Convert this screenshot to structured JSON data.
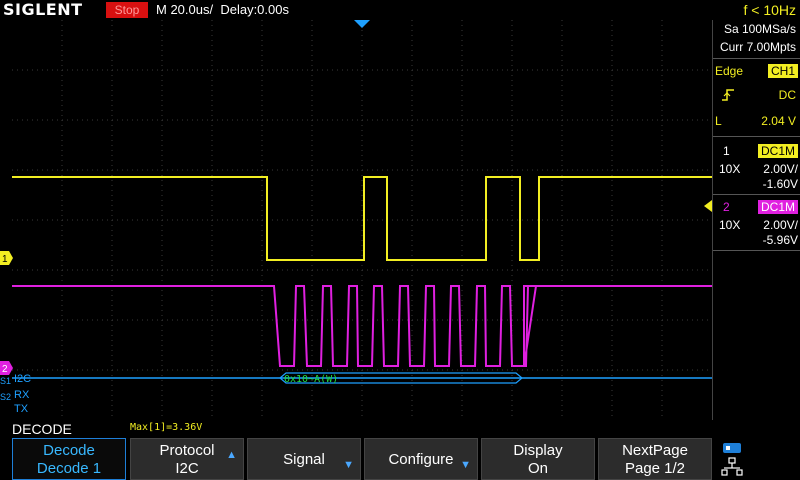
{
  "header": {
    "brand": "SIGLENT",
    "run_state": "Stop",
    "timebase": "M 20.0us/",
    "delay": "Delay:0.00s",
    "frequency": "f < 10Hz"
  },
  "acquisition": {
    "sample_rate": "Sa 100MSa/s",
    "memory": "Curr 7.00Mpts"
  },
  "trigger": {
    "type": "Edge",
    "source": "CH1",
    "coupling": "DC",
    "level_label": "L",
    "level": "2.04 V"
  },
  "channels": [
    {
      "number": "1",
      "coupling": "DC1M",
      "probe": "10X",
      "scale": "2.00V/",
      "offset": "-1.60V",
      "color": "#f2ee22"
    },
    {
      "number": "2",
      "coupling": "DC1M",
      "probe": "10X",
      "scale": "2.00V/",
      "offset": "-5.96V",
      "color": "#e020e0"
    }
  ],
  "markers": {
    "ch1": "1",
    "ch2": "2",
    "s1": "S1",
    "s2": "S2"
  },
  "bus": {
    "protocol_label": "I2C",
    "frame_text": "0x10~A(W)",
    "uart_rx": "RX",
    "uart_tx": "TX"
  },
  "measurement": {
    "max": "Max[1]=3.36V"
  },
  "menu": {
    "title": "DECODE",
    "keys": [
      {
        "line1": "Decode",
        "line2": "Decode 1",
        "arrow": ""
      },
      {
        "line1": "Protocol",
        "line2": "I2C",
        "arrow": "▲"
      },
      {
        "line1": "Signal",
        "line2": "",
        "arrow": "▼"
      },
      {
        "line1": "Configure",
        "line2": "",
        "arrow": "▼"
      },
      {
        "line1": "Display",
        "line2": "On",
        "arrow": ""
      },
      {
        "line1": "NextPage",
        "line2": "Page 1/2",
        "arrow": ""
      }
    ]
  },
  "colors": {
    "ch1": "#f2ee22",
    "ch2": "#e020e0",
    "bus": "#1ea0ff",
    "decode_text": "#20e040"
  }
}
